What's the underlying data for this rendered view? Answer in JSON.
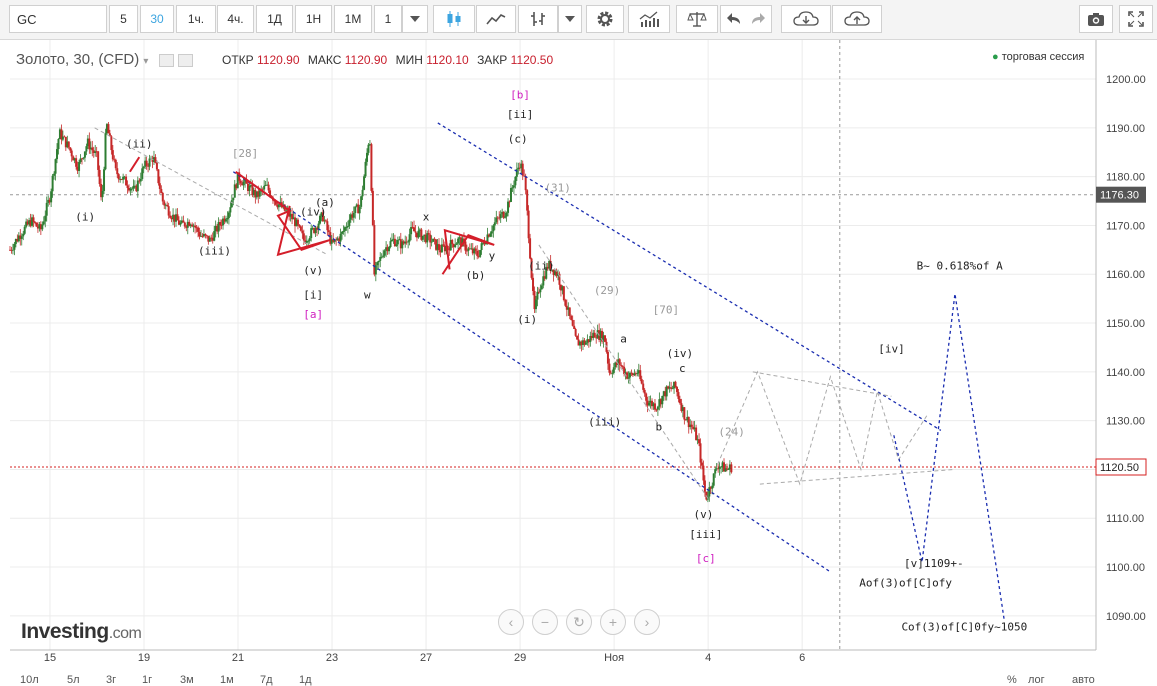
{
  "toolbar": {
    "symbol": "GC",
    "intervals": [
      "5",
      "30",
      "1ч.",
      "4ч.",
      "1Д",
      "1Н",
      "1М"
    ],
    "active_interval": "30",
    "count_value": "1",
    "icons": [
      "dropdown-icon",
      "candle-icon",
      "line-chart-icon",
      "bars-icon",
      "dropdown-icon",
      "gear-icon",
      "indicators-icon",
      "scales-icon",
      "undo-icon",
      "redo-icon",
      "cloud-download-icon",
      "cloud-upload-icon",
      "camera-icon",
      "fullscreen-icon"
    ]
  },
  "legend": {
    "title": "Золото, 30, (CFD)",
    "ohlc": [
      {
        "label": "ОТКР",
        "value": "1120.90"
      },
      {
        "label": "МАКС",
        "value": "1120.90"
      },
      {
        "label": "МИН",
        "value": "1120.10"
      },
      {
        "label": "ЗАКР",
        "value": "1120.50"
      }
    ],
    "session": "торговая сессия"
  },
  "colors": {
    "up": "#2e7d32",
    "down": "#c62828",
    "channel": "#1a2db0",
    "projection": "#1a2db0",
    "grey": "#aaaaaa",
    "price_line": "#d62020",
    "magenta": "#d020c0",
    "triangle": "#d41e2a"
  },
  "chart_data": {
    "type": "candlestick",
    "interval": "30",
    "ylim": [
      1083,
      1208
    ],
    "y_ticks": [
      "1090.00",
      "1100.00",
      "1110.00",
      "1120.00",
      "1130.00",
      "1140.00",
      "1150.00",
      "1160.00",
      "1170.00",
      "1180.00",
      "1190.00",
      "1200.00"
    ],
    "x_ticks": [
      {
        "label": "15",
        "t": 1.7
      },
      {
        "label": "19",
        "t": 5.7
      },
      {
        "label": "21",
        "t": 9.7
      },
      {
        "label": "23",
        "t": 13.7
      },
      {
        "label": "27",
        "t": 17.7
      },
      {
        "label": "29",
        "t": 21.7
      },
      {
        "label": "Ноя",
        "t": 25.7
      },
      {
        "label": "4",
        "t": 29.7
      },
      {
        "label": "6",
        "t": 33.7
      }
    ],
    "xlim": [
      0,
      46.2
    ],
    "last_price": "1120.50",
    "crosshair_price": "1176.30",
    "crosshair_t": 35.3,
    "price_path": [
      [
        0,
        1165
      ],
      [
        0.4,
        1168
      ],
      [
        0.9,
        1171
      ],
      [
        1.3,
        1169
      ],
      [
        1.7,
        1176
      ],
      [
        2.1,
        1189
      ],
      [
        2.5,
        1186
      ],
      [
        2.9,
        1182
      ],
      [
        3.3,
        1187
      ],
      [
        3.7,
        1184
      ],
      [
        3.9,
        1174
      ],
      [
        4.1,
        1191
      ],
      [
        4.5,
        1181
      ],
      [
        4.9,
        1179
      ],
      [
        5.3,
        1177
      ],
      [
        5.7,
        1182
      ],
      [
        6.1,
        1184
      ],
      [
        6.5,
        1175
      ],
      [
        6.9,
        1172
      ],
      [
        7.3,
        1170
      ],
      [
        7.7,
        1171
      ],
      [
        8.1,
        1168
      ],
      [
        8.5,
        1167
      ],
      [
        8.9,
        1170
      ],
      [
        9.3,
        1173
      ],
      [
        9.7,
        1180
      ],
      [
        10.1,
        1178
      ],
      [
        10.5,
        1176
      ],
      [
        10.9,
        1178
      ],
      [
        11.3,
        1175
      ],
      [
        11.7,
        1173
      ],
      [
        12.1,
        1171
      ],
      [
        12.5,
        1167
      ],
      [
        12.9,
        1169
      ],
      [
        13.3,
        1172
      ],
      [
        13.7,
        1166
      ],
      [
        14.1,
        1168
      ],
      [
        14.5,
        1172
      ],
      [
        14.9,
        1174
      ],
      [
        15.3,
        1189
      ],
      [
        15.5,
        1160
      ],
      [
        15.9,
        1165
      ],
      [
        16.3,
        1167
      ],
      [
        16.7,
        1166
      ],
      [
        17.1,
        1169
      ],
      [
        17.5,
        1168
      ],
      [
        17.9,
        1167
      ],
      [
        18.3,
        1165
      ],
      [
        18.7,
        1166
      ],
      [
        19.1,
        1167
      ],
      [
        19.5,
        1165
      ],
      [
        19.9,
        1164
      ],
      [
        20.3,
        1168
      ],
      [
        20.7,
        1171
      ],
      [
        21.1,
        1173
      ],
      [
        21.5,
        1180
      ],
      [
        21.7,
        1183
      ],
      [
        21.9,
        1179
      ],
      [
        22.1,
        1166
      ],
      [
        22.3,
        1152
      ],
      [
        22.5,
        1157
      ],
      [
        22.9,
        1162
      ],
      [
        23.3,
        1160
      ],
      [
        23.7,
        1153
      ],
      [
        24.1,
        1146
      ],
      [
        24.5,
        1146
      ],
      [
        24.9,
        1148
      ],
      [
        25.3,
        1147
      ],
      [
        25.5,
        1140
      ],
      [
        25.9,
        1142
      ],
      [
        26.3,
        1139
      ],
      [
        26.7,
        1140
      ],
      [
        27.1,
        1134
      ],
      [
        27.5,
        1133
      ],
      [
        27.9,
        1136
      ],
      [
        28.3,
        1137
      ],
      [
        28.7,
        1131
      ],
      [
        29.1,
        1128
      ],
      [
        29.3,
        1125
      ],
      [
        29.6,
        1114
      ],
      [
        29.9,
        1118
      ],
      [
        30.1,
        1121
      ],
      [
        30.5,
        1120
      ],
      [
        30.7,
        1120.5
      ]
    ],
    "price_noise_seed": 7,
    "channel_lines": [
      {
        "id": "upper",
        "points": [
          [
            18.2,
            1191
          ],
          [
            39.6,
            1128
          ]
        ]
      },
      {
        "id": "lower",
        "points": [
          [
            9.5,
            1181
          ],
          [
            34.9,
            1099
          ]
        ]
      }
    ],
    "grey_trend_lines": [
      {
        "points": [
          [
            3.6,
            1190
          ],
          [
            13.5,
            1164
          ]
        ]
      },
      {
        "points": [
          [
            22.5,
            1166
          ],
          [
            29.7,
            1114
          ]
        ]
      },
      {
        "points": [
          [
            31.9,
            1117
          ],
          [
            40.2,
            1120
          ]
        ]
      },
      {
        "points": [
          [
            31.6,
            1140
          ],
          [
            37.5,
            1135
          ]
        ]
      }
    ],
    "zigzag_grey": [
      [
        30.1,
        1121
      ],
      [
        31.8,
        1140
      ],
      [
        33.6,
        1117
      ],
      [
        34.9,
        1139
      ],
      [
        36.2,
        1120
      ],
      [
        36.9,
        1136
      ],
      [
        37.8,
        1122
      ],
      [
        39.0,
        1131
      ]
    ],
    "projection_blue": [
      [
        37.6,
        1127
      ],
      [
        38.8,
        1101
      ],
      [
        40.2,
        1156
      ],
      [
        42.3,
        1089
      ]
    ],
    "red_triangles": [
      {
        "points": [
          [
            9.6,
            1181
          ],
          [
            11.9,
            1173
          ],
          [
            11.4,
            1172
          ],
          [
            12.4,
            1165
          ],
          [
            13.6,
            1167
          ],
          [
            11.4,
            1164
          ],
          [
            11.9,
            1174
          ]
        ]
      },
      {
        "points": [
          [
            18.4,
            1160
          ],
          [
            19.5,
            1168
          ],
          [
            20.6,
            1166
          ],
          [
            18.5,
            1169
          ],
          [
            18.7,
            1161
          ]
        ]
      },
      {
        "points": [
          [
            5.1,
            1181
          ],
          [
            5.5,
            1184
          ]
        ]
      }
    ],
    "annotations": [
      {
        "text": "(i)",
        "t": 3.2,
        "y": 1171,
        "color": "#222"
      },
      {
        "text": "(ii)",
        "t": 5.5,
        "y": 1186,
        "color": "#222"
      },
      {
        "text": "(iii)",
        "t": 8.7,
        "y": 1164,
        "color": "#222"
      },
      {
        "text": "[28]",
        "t": 10.0,
        "y": 1184,
        "color": "#999"
      },
      {
        "text": "(iv)",
        "t": 12.9,
        "y": 1172,
        "color": "#222"
      },
      {
        "text": "(a)",
        "t": 13.4,
        "y": 1174,
        "color": "#222"
      },
      {
        "text": "(v)",
        "t": 12.9,
        "y": 1160,
        "color": "#222"
      },
      {
        "text": "[i]",
        "t": 12.9,
        "y": 1155,
        "color": "#222"
      },
      {
        "text": "[a]",
        "t": 12.9,
        "y": 1151,
        "color": "#d020c0"
      },
      {
        "text": "w",
        "t": 15.2,
        "y": 1155,
        "color": "#222"
      },
      {
        "text": "x",
        "t": 17.7,
        "y": 1171,
        "color": "#222"
      },
      {
        "text": "y",
        "t": 20.5,
        "y": 1163,
        "color": "#222"
      },
      {
        "text": "(b)",
        "t": 19.8,
        "y": 1159,
        "color": "#222"
      },
      {
        "text": "[b]",
        "t": 21.7,
        "y": 1196,
        "color": "#d020c0"
      },
      {
        "text": "[ii]",
        "t": 21.7,
        "y": 1192,
        "color": "#222"
      },
      {
        "text": "(c)",
        "t": 21.6,
        "y": 1187,
        "color": "#222"
      },
      {
        "text": "(31)",
        "t": 23.3,
        "y": 1177,
        "color": "#999"
      },
      {
        "text": "(ii)",
        "t": 22.6,
        "y": 1161,
        "color": "#222"
      },
      {
        "text": "(i)",
        "t": 22.0,
        "y": 1150,
        "color": "#222"
      },
      {
        "text": "(29)",
        "t": 25.4,
        "y": 1156,
        "color": "#999"
      },
      {
        "text": "[70]",
        "t": 27.9,
        "y": 1152,
        "color": "#999"
      },
      {
        "text": "a",
        "t": 26.1,
        "y": 1146,
        "color": "#222"
      },
      {
        "text": "(iv)",
        "t": 28.5,
        "y": 1143,
        "color": "#222"
      },
      {
        "text": "c",
        "t": 28.6,
        "y": 1140,
        "color": "#222"
      },
      {
        "text": "(iii)",
        "t": 25.3,
        "y": 1129,
        "color": "#222"
      },
      {
        "text": "b",
        "t": 27.6,
        "y": 1128,
        "color": "#222"
      },
      {
        "text": "(24)",
        "t": 30.7,
        "y": 1127,
        "color": "#999"
      },
      {
        "text": "(v)",
        "t": 29.5,
        "y": 1110,
        "color": "#222"
      },
      {
        "text": "[iii]",
        "t": 29.6,
        "y": 1106,
        "color": "#222"
      },
      {
        "text": "[c]",
        "t": 29.6,
        "y": 1101,
        "color": "#d020c0"
      },
      {
        "text": "[iv]",
        "t": 37.5,
        "y": 1144,
        "color": "#222"
      },
      {
        "text": "B~ 0.618%of A",
        "t": 40.4,
        "y": 1161,
        "color": "#222"
      },
      {
        "text": "[v]1109+-",
        "t": 39.3,
        "y": 1100,
        "color": "#222"
      },
      {
        "text": "Aof(3)of[C]ofy",
        "t": 38.1,
        "y": 1096,
        "color": "#222"
      },
      {
        "text": "Cof(3)of[C]0fy~1050",
        "t": 40.6,
        "y": 1087,
        "color": "#222"
      }
    ]
  },
  "time_ranges": [
    "10л",
    "5л",
    "3г",
    "1г",
    "3м",
    "1м",
    "7д",
    "1д"
  ],
  "bottom_right": [
    "%",
    "лог",
    "авто"
  ],
  "logo": {
    "main": "Investing",
    "suffix": ".com"
  }
}
